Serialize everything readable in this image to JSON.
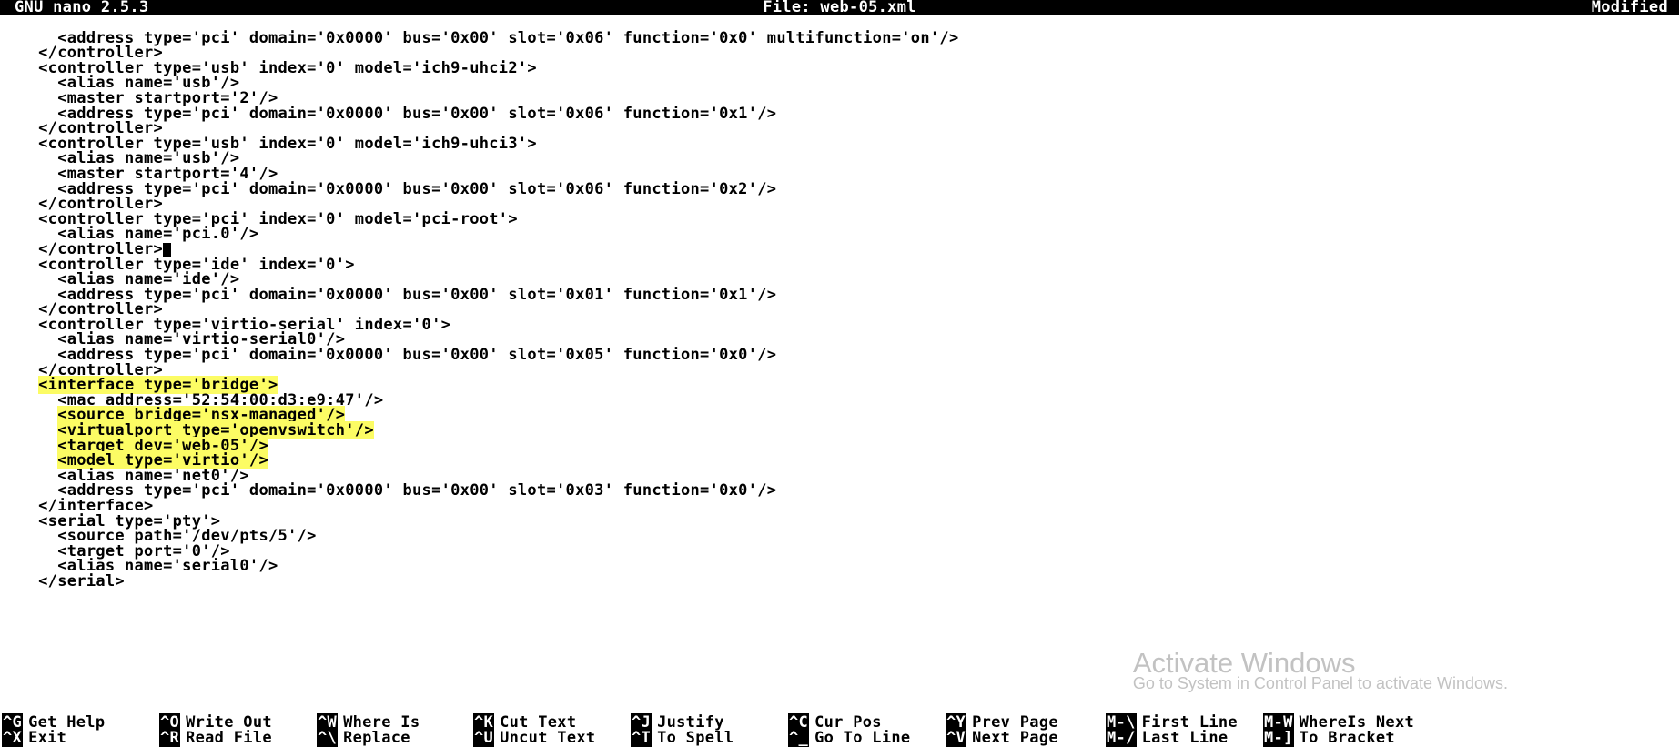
{
  "title": {
    "app": "GNU nano 2.5.3",
    "file": "File: web-05.xml",
    "status": "Modified"
  },
  "lines": [
    {
      "pad": "      ",
      "text": "<address type='pci' domain='0x0000' bus='0x00' slot='0x06' function='0x0' multifunction='on'/>"
    },
    {
      "pad": "    ",
      "text": "</controller>"
    },
    {
      "pad": "    ",
      "text": "<controller type='usb' index='0' model='ich9-uhci2'>"
    },
    {
      "pad": "      ",
      "text": "<alias name='usb'/>"
    },
    {
      "pad": "      ",
      "text": "<master startport='2'/>"
    },
    {
      "pad": "      ",
      "text": "<address type='pci' domain='0x0000' bus='0x00' slot='0x06' function='0x1'/>"
    },
    {
      "pad": "    ",
      "text": "</controller>"
    },
    {
      "pad": "    ",
      "text": "<controller type='usb' index='0' model='ich9-uhci3'>"
    },
    {
      "pad": "      ",
      "text": "<alias name='usb'/>"
    },
    {
      "pad": "      ",
      "text": "<master startport='4'/>"
    },
    {
      "pad": "      ",
      "text": "<address type='pci' domain='0x0000' bus='0x00' slot='0x06' function='0x2'/>"
    },
    {
      "pad": "    ",
      "text": "</controller>"
    },
    {
      "pad": "    ",
      "text": "<controller type='pci' index='0' model='pci-root'>"
    },
    {
      "pad": "      ",
      "text": "<alias name='pci.0'/>"
    },
    {
      "pad": "    ",
      "text": "</controller>",
      "cursor": true
    },
    {
      "pad": "    ",
      "text": "<controller type='ide' index='0'>"
    },
    {
      "pad": "      ",
      "text": "<alias name='ide'/>"
    },
    {
      "pad": "      ",
      "text": "<address type='pci' domain='0x0000' bus='0x00' slot='0x01' function='0x1'/>"
    },
    {
      "pad": "    ",
      "text": "</controller>"
    },
    {
      "pad": "    ",
      "text": "<controller type='virtio-serial' index='0'>"
    },
    {
      "pad": "      ",
      "text": "<alias name='virtio-serial0'/>"
    },
    {
      "pad": "      ",
      "text": "<address type='pci' domain='0x0000' bus='0x00' slot='0x05' function='0x0'/>"
    },
    {
      "pad": "    ",
      "text": "</controller>"
    },
    {
      "pad": "    ",
      "hl": true,
      "text": "<interface type='bridge'>"
    },
    {
      "pad": "      ",
      "text": "<mac address='52:54:00:d3:e9:47'/>"
    },
    {
      "pad": "      ",
      "hl": true,
      "text": "<source bridge='nsx-managed'/>"
    },
    {
      "pad": "      ",
      "hl": true,
      "text": "<virtualport type='openvswitch'/>"
    },
    {
      "pad": "      ",
      "hl": true,
      "text": "<target dev='web-05'/>"
    },
    {
      "pad": "      ",
      "hl": true,
      "text": "<model type='virtio'/>"
    },
    {
      "pad": "      ",
      "text": "<alias name='net0'/>"
    },
    {
      "pad": "      ",
      "text": "<address type='pci' domain='0x0000' bus='0x00' slot='0x03' function='0x0'/>"
    },
    {
      "pad": "    ",
      "text": "</interface>"
    },
    {
      "pad": "    ",
      "text": "<serial type='pty'>"
    },
    {
      "pad": "      ",
      "text": "<source path='/dev/pts/5'/>"
    },
    {
      "pad": "      ",
      "text": "<target port='0'/>"
    },
    {
      "pad": "      ",
      "text": "<alias name='serial0'/>"
    },
    {
      "pad": "    ",
      "text": "</serial>"
    }
  ],
  "help": {
    "row1": [
      {
        "key": "^G",
        "label": "Get Help"
      },
      {
        "key": "^O",
        "label": "Write Out"
      },
      {
        "key": "^W",
        "label": "Where Is"
      },
      {
        "key": "^K",
        "label": "Cut Text"
      },
      {
        "key": "^J",
        "label": "Justify"
      },
      {
        "key": "^C",
        "label": "Cur Pos"
      },
      {
        "key": "^Y",
        "label": "Prev Page"
      },
      {
        "key": "M-\\",
        "label": "First Line"
      },
      {
        "key": "M-W",
        "label": "WhereIs Next"
      }
    ],
    "row2": [
      {
        "key": "^X",
        "label": "Exit"
      },
      {
        "key": "^R",
        "label": "Read File"
      },
      {
        "key": "^\\",
        "label": "Replace"
      },
      {
        "key": "^U",
        "label": "Uncut Text"
      },
      {
        "key": "^T",
        "label": "To Spell"
      },
      {
        "key": "^_",
        "label": "Go To Line"
      },
      {
        "key": "^V",
        "label": "Next Page"
      },
      {
        "key": "M-/",
        "label": "Last Line"
      },
      {
        "key": "M-]",
        "label": "To Bracket"
      }
    ]
  },
  "watermark": {
    "title": "Activate Windows",
    "sub": "Go to System in Control Panel to activate Windows."
  },
  "col_lefts": [
    2,
    175,
    348,
    520,
    693,
    866,
    1039,
    1215,
    1388
  ]
}
